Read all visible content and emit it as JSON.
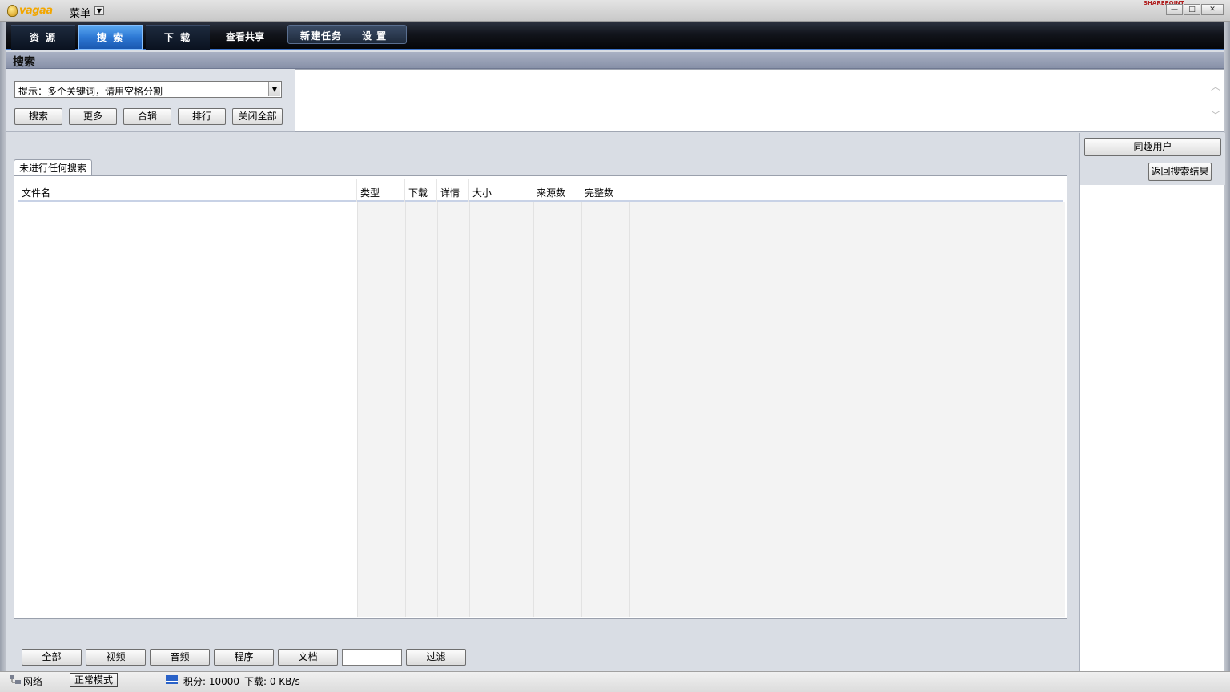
{
  "app": {
    "logo_text": "vagaa",
    "menu_label": "菜单",
    "brand_mini": "SHAREPOINT"
  },
  "window_controls": {
    "minimize": "—",
    "maximize": "□",
    "close": "✕"
  },
  "nav": {
    "tabs": [
      {
        "label": "资 源",
        "active": false
      },
      {
        "label": "搜 索",
        "active": true
      },
      {
        "label": "下 载",
        "active": false
      },
      {
        "label": "查看共享",
        "active": false
      }
    ],
    "new_task": "新建任务",
    "settings": "设 置"
  },
  "section": {
    "title": "搜索"
  },
  "search": {
    "combo_value": "提示：多个关键词，请用空格分割",
    "buttons": [
      "搜索",
      "更多",
      "合辑",
      "排行",
      "关闭全部"
    ]
  },
  "results": {
    "tab_label": "未进行任何搜索",
    "columns": [
      "文件名",
      "类型",
      "下载",
      "详情",
      "大小",
      "来源数",
      "完整数"
    ],
    "rows": []
  },
  "filter": {
    "buttons": [
      "全部",
      "视频",
      "音频",
      "程序",
      "文档"
    ],
    "input_value": "",
    "apply": "过滤"
  },
  "right_panel": {
    "peers_button": "同趣用户",
    "back_button": "返回搜索结果"
  },
  "status": {
    "network": "网络",
    "mode": "正常模式",
    "score": "积分: 10000",
    "download_speed": "下载: 0 KB/s"
  },
  "colors": {
    "accent": "#2d78d4",
    "nav_bg": "#12151c",
    "panel_bg": "#d9dde4"
  }
}
